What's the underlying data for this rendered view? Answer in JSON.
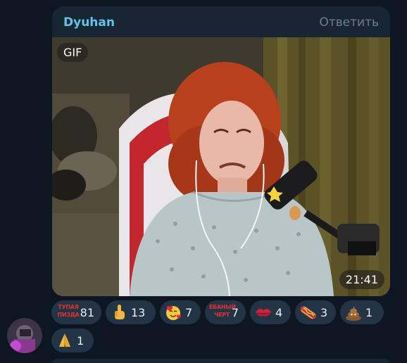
{
  "message": {
    "sender": "Dyuhan",
    "reply_label": "Ответить",
    "media_badge": "GIF",
    "duration": "21:41"
  },
  "reactions": [
    {
      "icon": "text-sticker",
      "text": "ТУПАЯ ПИЗДА",
      "count": "81"
    },
    {
      "icon": "pointing-up-hand-emoji",
      "count": "13"
    },
    {
      "icon": "smiling-face-with-hearts-emoji",
      "count": "7"
    },
    {
      "icon": "text-sticker",
      "text": "ЕБАНЫЙ ЧЕРТ",
      "count": "7"
    },
    {
      "icon": "kiss-mark-emoji",
      "count": "4"
    },
    {
      "icon": "hot-dog-emoji",
      "count": "3"
    },
    {
      "icon": "pile-of-poo-emoji",
      "count": "1"
    },
    {
      "icon": "folded-hands-emoji",
      "count": "1"
    }
  ],
  "colors": {
    "background": "#0e1621",
    "bubble": "#182533",
    "sender_name": "#5fc5e8",
    "reply_text": "#6d7f8f",
    "reaction_pill": "#243447"
  }
}
